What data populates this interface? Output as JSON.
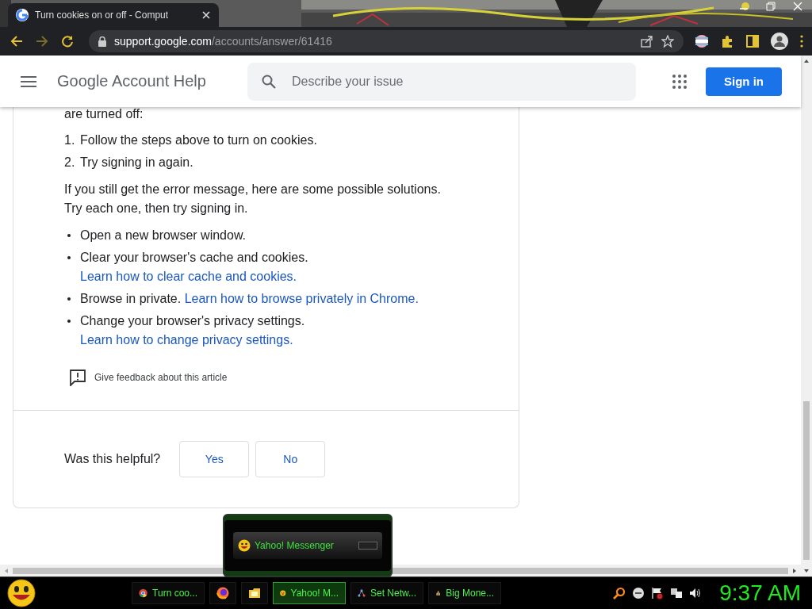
{
  "browser": {
    "tab": {
      "title": "Turn cookies on or off - Comput",
      "selected": true
    },
    "address": {
      "domain": "support.google.com",
      "path": "/accounts/answer/61416"
    }
  },
  "header": {
    "title": "Google Account Help",
    "search": {
      "placeholder": "Describe your issue"
    },
    "sign_in": "Sign in"
  },
  "article": {
    "intro": "are turned off:",
    "steps": [
      {
        "number": "1.",
        "text": "Follow the steps above to turn on cookies."
      },
      {
        "number": "2.",
        "text": "Try signing in again."
      }
    ],
    "paragraph": "If you still get the error message, here are some possible solutions. Try each one, then try signing in.",
    "solutions": [
      {
        "text": "Open a new browser window."
      },
      {
        "text": "Clear your browser's cache and cookies.",
        "link": "Learn how to clear cache and cookies."
      },
      {
        "text": "Browse in private.",
        "link": "Learn how to browse privately in Chrome."
      },
      {
        "text": "Change your browser's privacy settings.",
        "link": "Learn how to change privacy settings."
      }
    ],
    "feedback": "Give feedback about this article",
    "helpful": {
      "question": "Was this helpful?",
      "buttons": [
        "Yes",
        "No"
      ]
    }
  },
  "popup": {
    "title": "Yahoo! Messenger"
  },
  "taskbar": {
    "items": [
      {
        "kind": "chrome",
        "label": "Turn coo...",
        "selected": false
      },
      {
        "kind": "firefox",
        "selected": false
      },
      {
        "kind": "folder",
        "selected": false
      },
      {
        "kind": "smiley",
        "label": "Yahoo! M...",
        "selected": true
      },
      {
        "kind": "network",
        "label": "Set Netw...",
        "selected": false
      },
      {
        "kind": "bag",
        "label": "Big Mone...",
        "selected": false
      }
    ],
    "clock": "9:37 AM"
  }
}
